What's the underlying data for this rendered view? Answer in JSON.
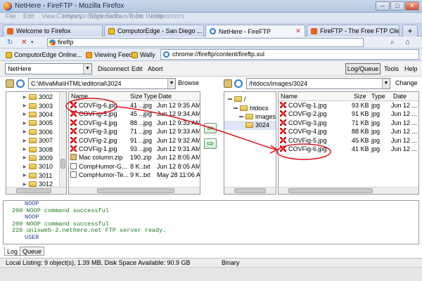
{
  "window": {
    "title": "NetHere - FireFTP - Mozilla Firefox",
    "buttons": [
      "–",
      "□",
      "✕"
    ]
  },
  "menubar": {
    "items": [
      "File",
      "Edit",
      "View",
      "History",
      "Bookmarks",
      "Tools",
      "Help"
    ],
    "ghost_text": "ComputorEdge Software for Webmasters"
  },
  "tabs": [
    {
      "label": "Welcome to Firefox",
      "icon_color": "#e5641c",
      "active": false
    },
    {
      "label": "ComputorEdge - San Diego ...",
      "icon_color": "#3d6fc7",
      "active": false
    },
    {
      "label": "NetHere - FireFTP",
      "icon_color": "#2e7dd6",
      "active": true
    },
    {
      "label": "FireFTP - The Free FTP Clien...",
      "icon_color": "#e5641c",
      "active": false
    }
  ],
  "tab_controls": {
    "new_tab": "+"
  },
  "nav": {
    "search_value": "fireftp",
    "home_icon": "home-icon"
  },
  "bookmarks": [
    {
      "label": "ComputorEdge Online..."
    },
    {
      "label": "Viewing Feed"
    },
    {
      "label": "Wally"
    }
  ],
  "address": {
    "url": "chrome://fireftp/content/fireftp.xul"
  },
  "ftp_toolbar": {
    "account": "NetHere",
    "disconnect": "Disconnect",
    "edit": "Edit",
    "abort": "Abort",
    "log_queue": "Log/Queue",
    "tools": "Tools",
    "help": "Help"
  },
  "local": {
    "path": "C:\\MivaMia\\HTML\\editorial\\3024",
    "browse": "Browse",
    "folders": [
      "3002",
      "3003",
      "3004",
      "3005",
      "3006",
      "3007",
      "3008",
      "3009",
      "3010",
      "3011",
      "3012"
    ],
    "columns": {
      "name": "Name",
      "size": "Size",
      "type": "Type",
      "date": "Date"
    },
    "files": [
      {
        "name": "COVFig-6.jpg",
        "size": "41 ...",
        "type": "jpg",
        "date": "Jun 12 9:35 AM",
        "icon": "jpg"
      },
      {
        "name": "COVFig-5.jpg",
        "size": "45 ...",
        "type": "jpg",
        "date": "Jun 12 9:34 AM",
        "icon": "jpg"
      },
      {
        "name": "COVFig-4.jpg",
        "size": "88 ...",
        "type": "jpg",
        "date": "Jun 12 9:33 AM",
        "icon": "jpg"
      },
      {
        "name": "COVFig-3.jpg",
        "size": "71 ...",
        "type": "jpg",
        "date": "Jun 12 9:33 AM",
        "icon": "jpg"
      },
      {
        "name": "COVFig-2.jpg",
        "size": "91 ...",
        "type": "jpg",
        "date": "Jun 12 9:32 AM",
        "icon": "jpg"
      },
      {
        "name": "COVFig-1.jpg",
        "size": "93 ...",
        "type": "jpg",
        "date": "Jun 12 9:31 AM",
        "icon": "jpg"
      },
      {
        "name": "Mac column.zip",
        "size": "190...",
        "type": "zip",
        "date": "Jun 12 8:05 AM",
        "icon": "zip"
      },
      {
        "name": "CompHumor-G...",
        "size": "8 K...",
        "type": "txt",
        "date": "Jun 12 8:05 AM",
        "icon": "txt"
      },
      {
        "name": "CompHumor-Te...",
        "size": "9 K...",
        "type": "txt",
        "date": "May 28 11:06 AM",
        "icon": "txt"
      }
    ]
  },
  "remote": {
    "path": "/htdocs/images/3024",
    "change": "Change",
    "tree": [
      "/",
      "htdocs",
      "images",
      "3024"
    ],
    "columns": {
      "name": "Name",
      "size": "Size",
      "type": "Type",
      "date": "Date"
    },
    "files": [
      {
        "name": "COVFig-1.jpg",
        "size": "93 KB",
        "type": "jpg",
        "date": "Jun 12 ..."
      },
      {
        "name": "COVFig-2.jpg",
        "size": "91 KB",
        "type": "jpg",
        "date": "Jun 12 ..."
      },
      {
        "name": "COVFig-3.jpg",
        "size": "71 KB",
        "type": "jpg",
        "date": "Jun 12 ..."
      },
      {
        "name": "COVFig-4.jpg",
        "size": "88 KB",
        "type": "jpg",
        "date": "Jun 12 ..."
      },
      {
        "name": "COVFig-5.jpg",
        "size": "45 KB",
        "type": "jpg",
        "date": "Jun 12 ..."
      },
      {
        "name": "COVFig-6.jpg",
        "size": "41 KB",
        "type": "jpg",
        "date": "Jun 12 ..."
      }
    ]
  },
  "transfer": {
    "left_arrow": "⇦",
    "right_arrow": "⇨"
  },
  "log": {
    "lines": [
      {
        "text": "NOOP",
        "kind": "cmd"
      },
      {
        "text": "200 NOOP command successful",
        "kind": "ok"
      },
      {
        "text": "NOOP",
        "kind": "cmd"
      },
      {
        "text": "200 NOOP command successful",
        "kind": "ok"
      },
      {
        "text": "220 unixweb-2.nethere.net FTP server ready.",
        "kind": "ok"
      },
      {
        "text": "USER",
        "kind": "cmd"
      }
    ],
    "tabs": [
      "Log",
      "Queue"
    ]
  },
  "status": {
    "left": "Local Listing: 9 object(s), 1.39 MB, Disk Space Available: 90.9 GB",
    "mode": "Binary"
  },
  "annotation": {
    "color": "#e0101a"
  }
}
